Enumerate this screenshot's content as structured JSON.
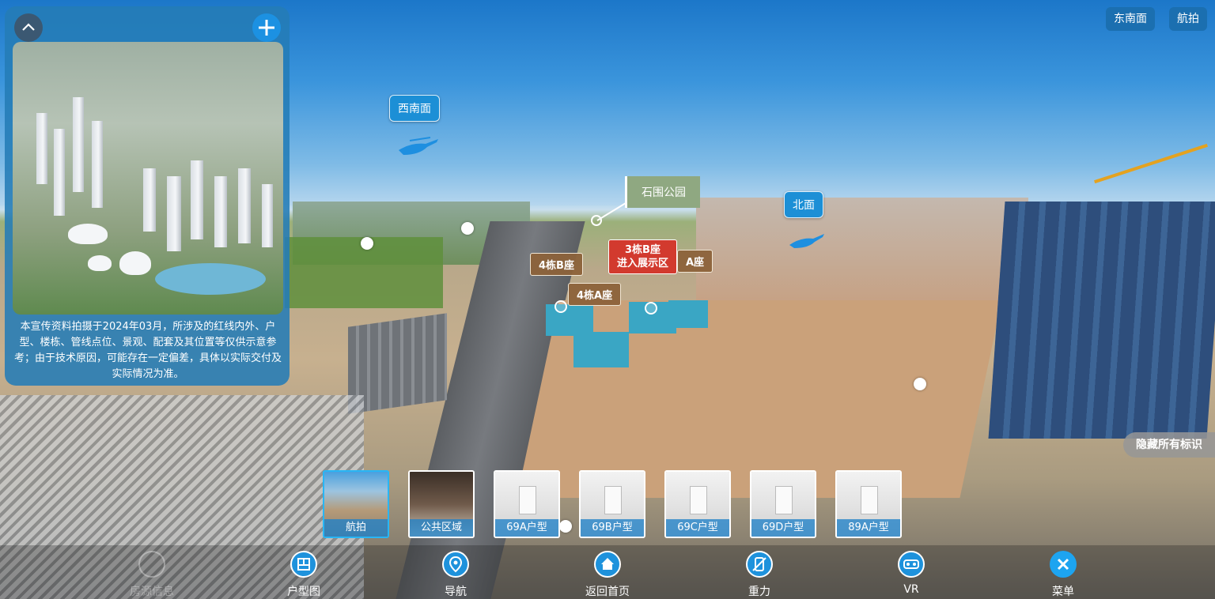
{
  "top_buttons": {
    "southeast": "东南面",
    "aerial": "航拍"
  },
  "info_panel": {
    "disclaimer": "本宣传资料拍摄于2024年03月，所涉及的红线内外、户型、楼栋、管线点位、景观、配套及其位置等仅供示意参考；由于技术原因，可能存在一定偏差，具体以实际交付及实际情况为准。"
  },
  "hotspots": {
    "southwest": "西南面",
    "north": "北面",
    "park": "石围公园",
    "b4": "4栋B座",
    "b3_line1": "3栋B座",
    "b3_line2": "进入展示区",
    "a3": "A座",
    "a4": "4栋A座"
  },
  "thumbnails": [
    {
      "label": "航拍",
      "kind": "aerial",
      "active": true
    },
    {
      "label": "公共区域",
      "kind": "public",
      "active": false
    },
    {
      "label": "69A户型",
      "kind": "room",
      "active": false
    },
    {
      "label": "69B户型",
      "kind": "room",
      "active": false
    },
    {
      "label": "69C户型",
      "kind": "room",
      "active": false
    },
    {
      "label": "69D户型",
      "kind": "room",
      "active": false
    },
    {
      "label": "89A户型",
      "kind": "room",
      "active": false
    }
  ],
  "hide_markers_label": "隐藏所有标识",
  "bottom_nav": {
    "source_info": "房源信息",
    "floor_plan": "户型图",
    "navigate": "导航",
    "home": "返回首页",
    "gravity": "重力",
    "vr": "VR",
    "menu": "菜单"
  },
  "icons": [
    "chevron-up-icon",
    "plus-icon",
    "helicopter-icon",
    "floor-plan-icon",
    "location-pin-icon",
    "home-icon",
    "gravity-icon",
    "vr-headset-icon",
    "close-icon"
  ],
  "colors": {
    "accent": "#1c8fd6",
    "tag_brown": "#8c623a",
    "tag_red": "#d23a2e",
    "park_green": "#8fa881"
  }
}
